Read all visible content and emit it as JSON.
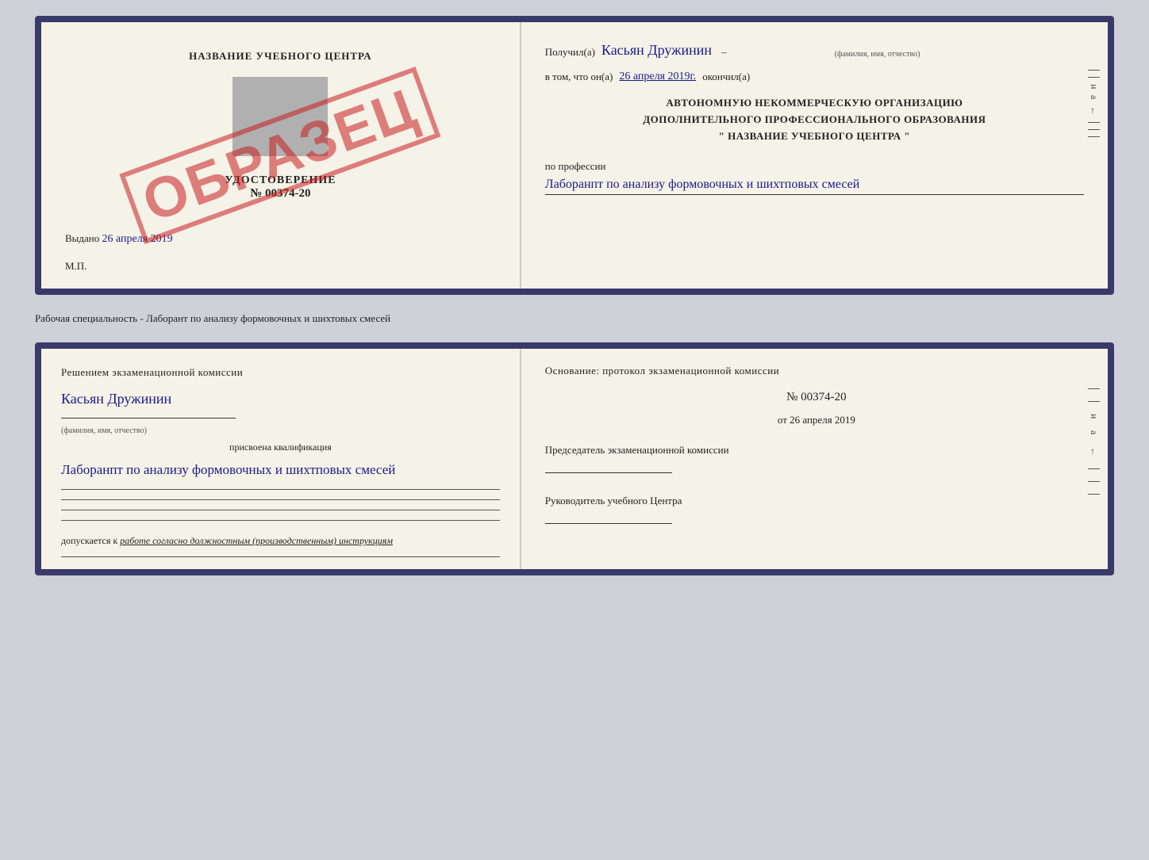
{
  "top_card": {
    "left": {
      "title": "НАЗВАНИЕ УЧЕБНОГО ЦЕНТРА",
      "stamp_text": "ОБРАЗЕЦ",
      "udostoverenie_label": "УДОСТОВЕРЕНИЕ",
      "number": "№ 00374-20",
      "vydano_label": "Выдано",
      "vydano_date": "26 апреля 2019",
      "mp": "М.П."
    },
    "right": {
      "poluchil_label": "Получил(a)",
      "recipient_name": "Касьян Дружинин",
      "fio_label": "(фамилия, имя, отчество)",
      "vtom_label": "в том, что он(а)",
      "date": "26 апреля 2019г.",
      "okonchil_label": "окончил(а)",
      "org_line1": "АВТОНОМНУЮ НЕКОММЕРЧЕСКУЮ ОРГАНИЗАЦИЮ",
      "org_line2": "ДОПОЛНИТЕЛЬНОГО ПРОФЕССИОНАЛЬНОГО ОБРАЗОВАНИЯ",
      "org_line3": "\"   НАЗВАНИЕ УЧЕБНОГО ЦЕНТРА   \"",
      "po_professii_label": "по профессии",
      "profession": "Лаборанпт по анализу формовочных и шихтповых смесей"
    }
  },
  "separator": {
    "text": "Рабочая специальность - Лаборант по анализу формовочных и шихтовых смесей"
  },
  "bottom_card": {
    "left": {
      "komissia_text": "Решением  экзаменационной  комиссии",
      "name_handwritten": "Касьян  Дружинин",
      "fio_label": "(фамилия, имя, отчество)",
      "prisvoena_label": "присвоена квалификация",
      "kvalifikacia": "Лаборанпт по анализу формовочных и шихтповых смесей",
      "dopuskaetsya_label": "допускается к",
      "dopuskaetsya_value": "работе согласно должностным (производственным) инструкциям"
    },
    "right": {
      "osnov_label": "Основание: протокол экзаменационной  комиссии",
      "number": "№  00374-20",
      "ot_label": "от",
      "ot_date": "26 апреля 2019",
      "predsedatel_label": "Председатель экзаменационной комиссии",
      "rukovoditel_label": "Руководитель учебного Центра"
    }
  }
}
